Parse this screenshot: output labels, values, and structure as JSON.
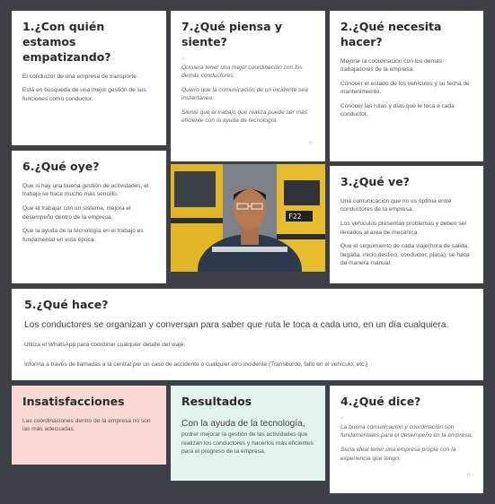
{
  "cards": {
    "empatizando": {
      "title": "1.¿Con quién estamos empatizando?",
      "p1": "El conductor de una empresa de transporte.",
      "p2": "Está en búsqueda de una mejor gestión de sus funciones como conductor."
    },
    "piensa": {
      "title": "7.¿Qué piensa y siente?",
      "q1": "Quisiera tener una mejor coordinación con los demás conductores.",
      "q2": "Quiero que la comunicación de un incidente sea instantánea.",
      "q3": "Siente que el trabajo que realiza puede ser más eficiente con la ayuda de tecnología."
    },
    "necesita": {
      "title": "2.¿Qué necesita hacer?",
      "p1": "Mejorar la coordinación con los demás trabajadores de la empresa.",
      "p2": "Conocer el estado de los vehículos y su fecha de mantenimiento.",
      "p3": "Conocer las rutas y días que le toca a cada conductor."
    },
    "oye": {
      "title": "6.¿Qué oye?",
      "p1": "Que si hay una buena gestión de actividades, el trabajo se hace mucho más sencillo.",
      "p2": "Que el trabajar con un sistema, mejora el desempeño dentro de la empresa.",
      "p3": "Que la ayuda de la tecnología en el trabajo es fundamental en esta época."
    },
    "ve": {
      "title": "3.¿Qué ve?",
      "p1": "Una comunicación que no es óptima entre conductores de la empresa.",
      "p2": "Los vehículos presentan problemas y deben ser llevados al área de mecánica.",
      "p3": "Que el seguimiento de cada viaje(hora de salida, llegada, inicio,destino, conductor, placa), se hace de manera manual."
    },
    "hace": {
      "title": "5.¿Qué hace?",
      "p1": "Los conductores se organizan y conversan para saber que ruta le toca a cada uno, en un día cualquiera.",
      "p2": "Utiliza el WhatsApp para coordinar cualquier detalle del viaje.",
      "p3": "Informa a través de llamadas a la central por un caso de accidente o cualquier otro incidente (Transbordo, fallo en el vehículo, etc.)"
    },
    "insatisfacciones": {
      "title": "Insatisfacciones",
      "p1": "Las coordinaciones dentro de la empresa no son las más adecuadas."
    },
    "resultados": {
      "title": "Resultados",
      "lead": "Con la ayuda de la tecnología,",
      "rest": " podrer mejorar la gestión de las actividades que realizan los conductores y hacerlos más eficientes para el progreso de la empresa."
    },
    "dice": {
      "title": "4.¿Qué dice?",
      "q1": "La buena comunicación y coordinación son fundamentales para el desempeño en la empresa.",
      "q2": "Sería ideal tener una empresa propia con la experiencia que tengo."
    }
  },
  "colors": {
    "background": "#3d4046",
    "insatisfacciones_bg": "#f9d9d3",
    "resultados_bg": "#e3f3ee"
  }
}
